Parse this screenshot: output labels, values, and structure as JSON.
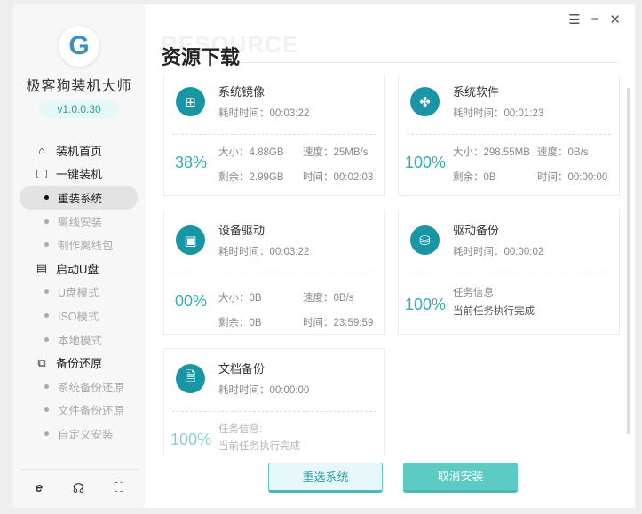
{
  "sidebar": {
    "app_name": "极客狗装机大师",
    "version": "v1.0.0.30",
    "groups": [
      {
        "label": "装机首页",
        "icon": "home-icon",
        "items": []
      },
      {
        "label": "一键装机",
        "icon": "monitor-icon",
        "items": [
          "重装系统",
          "离线安装",
          "制作离线包"
        ]
      },
      {
        "label": "启动U盘",
        "icon": "usb-icon",
        "items": [
          "U盘模式",
          "ISO模式",
          "本地模式"
        ]
      },
      {
        "label": "备份还原",
        "icon": "backup-icon",
        "items": [
          "系统备份还原",
          "文件备份还原",
          "自定义安装"
        ]
      }
    ],
    "active_item": "重装系统"
  },
  "header": {
    "title": "资源下载",
    "ghost": "RESOURCE"
  },
  "cards": [
    {
      "name": "系统镜像",
      "elapsed": "耗时时间：00:03:22",
      "percent": "38%",
      "size": "大小：4.88GB",
      "speed": "速度：25MB/s",
      "remain": "剩余：2.99GB",
      "time": "时间：00:02:03"
    },
    {
      "name": "系统软件",
      "elapsed": "耗时时间：00:01:23",
      "percent": "100%",
      "size": "大小：298.55MB",
      "speed": "速度：0B/s",
      "remain": "剩余：0B",
      "time": "时间：00:00:00"
    },
    {
      "name": "设备驱动",
      "elapsed": "耗时时间：00:03:22",
      "percent": "00%",
      "size": "大小：0B",
      "speed": "速度：0B/s",
      "remain": "剩余：0B",
      "time": "时间：23:59:59"
    },
    {
      "name": "驱动备份",
      "elapsed": "耗时时间：00:00:02",
      "percent": "100%",
      "info_label": "任务信息:",
      "info": "当前任务执行完成"
    },
    {
      "name": "文档备份",
      "elapsed": "耗时时间：00:00:00",
      "percent": "100%",
      "info_label": "任务信息:",
      "info": "当前任务执行完成"
    }
  ],
  "buttons": {
    "reselect": "重选系统",
    "cancel": "取消安装"
  },
  "colors": {
    "accent": "#1896a4",
    "button": "#5ccbc3"
  }
}
